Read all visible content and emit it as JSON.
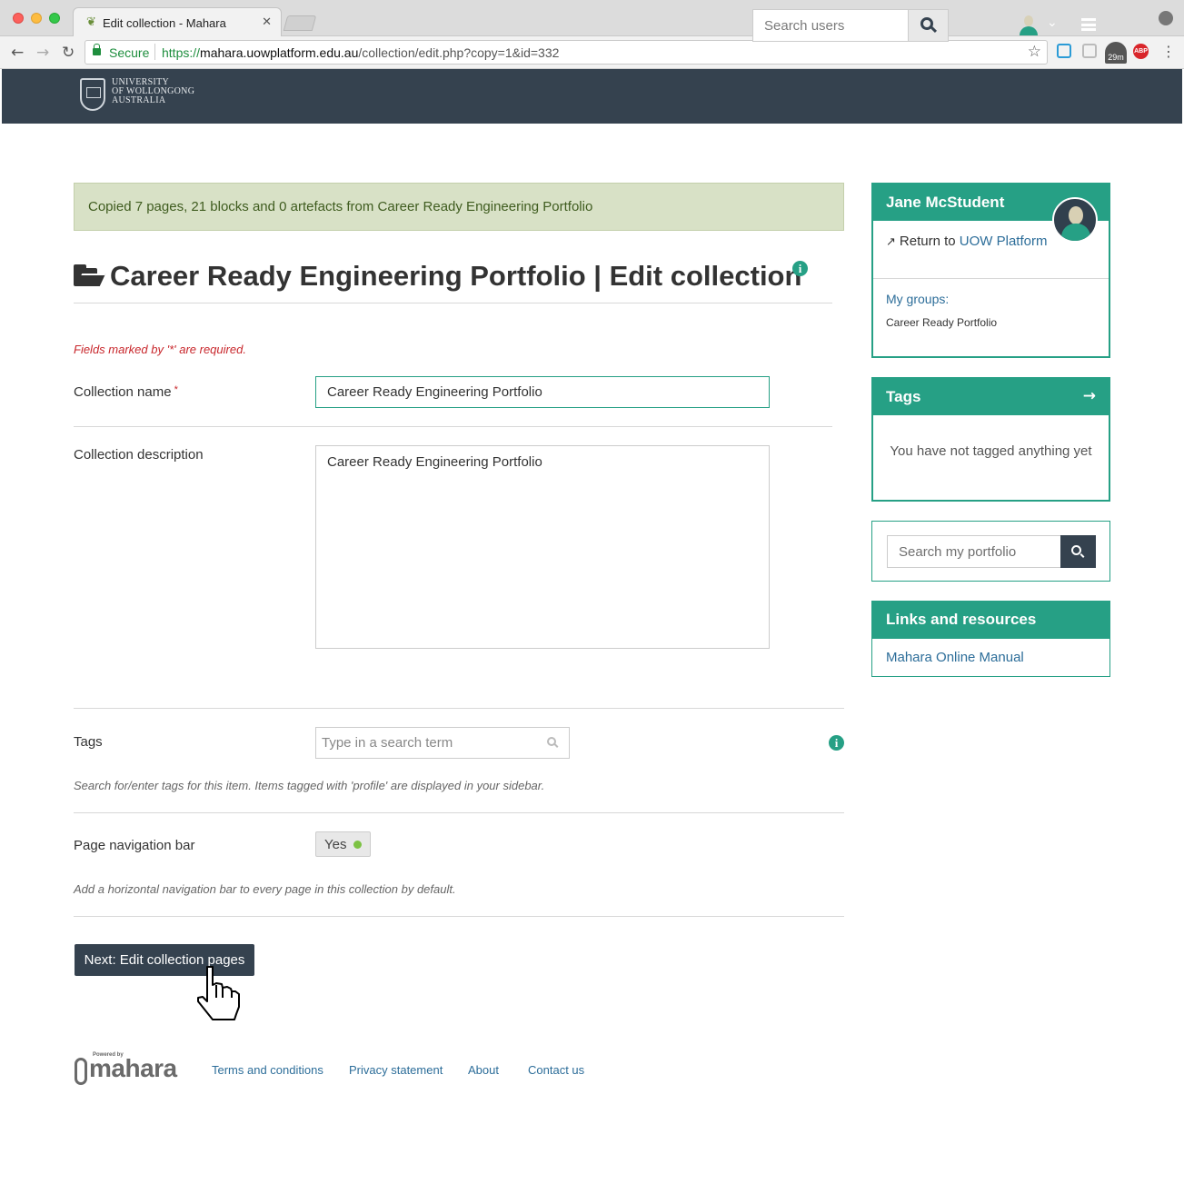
{
  "browser": {
    "tab_title": "Edit collection - Mahara",
    "secure_label": "Secure",
    "url_scheme": "https://",
    "url_host": "mahara.uowplatform.edu.au",
    "url_path": "/collection/edit.php?copy=1&id=332",
    "extension_badge": "29m",
    "abp_label": "ABP"
  },
  "header": {
    "logo_lines": [
      "UNIVERSITY",
      "OF WOLLONGONG",
      "AUSTRALIA"
    ],
    "search_placeholder": "Search users"
  },
  "alert": {
    "message": "Copied 7 pages, 21 blocks and 0 artefacts from Career Ready Engineering Portfolio"
  },
  "page": {
    "title": "Career Ready Engineering Portfolio | Edit collection",
    "required_note": "Fields marked by '*' are required."
  },
  "form": {
    "collection_name_label": "Collection name",
    "required_marker": "*",
    "collection_name_value": "Career Ready Engineering Portfolio",
    "collection_description_label": "Collection description",
    "collection_description_value": "Career Ready Engineering Portfolio",
    "tags_label": "Tags",
    "tags_placeholder": "Type in a search term",
    "tags_help": "Search for/enter tags for this item. Items tagged with 'profile' are displayed in your sidebar.",
    "nav_bar_label": "Page navigation bar",
    "nav_bar_value": "Yes",
    "nav_bar_help": "Add a horizontal navigation bar to every page in this collection by default.",
    "next_button": "Next: Edit collection pages"
  },
  "sidebar": {
    "profile": {
      "name": "Jane McStudent",
      "return_prefix": "Return to ",
      "return_link": "UOW Platform",
      "groups_label": "My groups:",
      "group_item": "Career Ready Portfolio"
    },
    "tags": {
      "title": "Tags",
      "empty_text": "You have not tagged anything yet"
    },
    "search": {
      "placeholder": "Search my portfolio"
    },
    "links": {
      "title": "Links and resources",
      "manual_link": "Mahara Online Manual"
    }
  },
  "footer": {
    "powered_by": "Powered by",
    "logo_word": "mahara",
    "links": [
      "Terms and conditions",
      "Privacy statement",
      "About",
      "Contact us"
    ]
  },
  "colors": {
    "header_bg": "#35424f",
    "accent": "#26a085",
    "alert_bg": "#d8e1c6",
    "required": "#c8262b",
    "link": "#2c6d99"
  }
}
